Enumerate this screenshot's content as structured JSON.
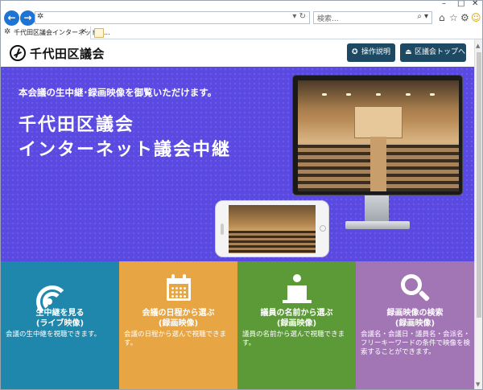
{
  "browser": {
    "address_value": "",
    "search_placeholder": "検索...",
    "tab_title": "千代田区議会インターネット議...",
    "tab_close": "×",
    "icons": [
      "back-icon",
      "forward-icon",
      "settings-icon",
      "refresh-icon",
      "search-icon",
      "home-icon",
      "star-icon",
      "gear-icon",
      "smiley-icon",
      "minimize-icon",
      "maximize-icon",
      "close-icon"
    ]
  },
  "header": {
    "site_title": "千代田区議会",
    "btn_help": "操作説明",
    "btn_top": "区議会トップへ"
  },
  "hero": {
    "subtitle": "本会議の生中継･録画映像を御覧いただけます。",
    "title_line1": "千代田区議会",
    "title_line2": "インターネット議会中継",
    "bg_color": "#5b4ae2"
  },
  "tiles": [
    {
      "title_line1": "生中継を見る",
      "title_line2": "(ライブ映像)",
      "desc": "会議の生中継を視聴できます。",
      "color": "#1f87ac",
      "icon": "broadcast-icon"
    },
    {
      "title_line1": "会議の日程から選ぶ",
      "title_line2": "(録画映像)",
      "desc": "会議の日程から選んで視聴できます。",
      "color": "#e7a544",
      "icon": "calendar-icon"
    },
    {
      "title_line1": "議員の名前から選ぶ",
      "title_line2": "(録画映像)",
      "desc": "議員の名前から選んで視聴できます。",
      "color": "#5c9a37",
      "icon": "speaker-podium-icon"
    },
    {
      "title_line1": "録画映像の検索",
      "title_line2": "(録画映像)",
      "desc": "会議名・会議日・議員名・会派名・フリーキーワードの条件で映像を検索することができます。",
      "color": "#a276b5",
      "icon": "search-icon"
    }
  ]
}
